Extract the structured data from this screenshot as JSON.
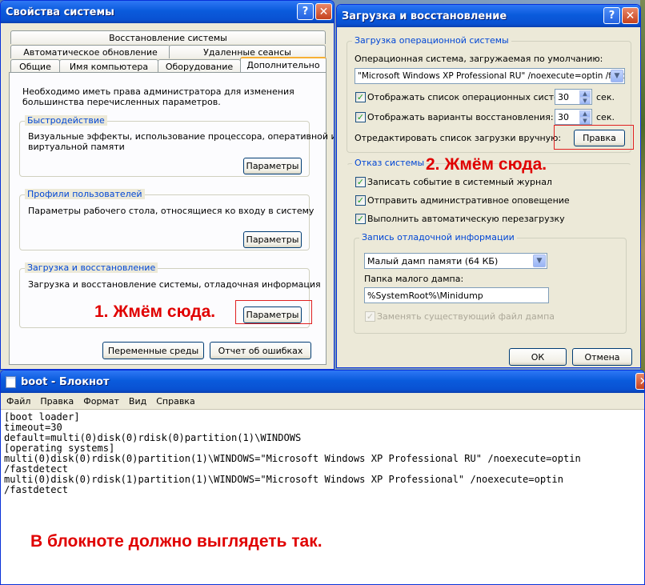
{
  "system_properties": {
    "title": "Свойства системы",
    "tabs_row1": [
      "Восстановление системы"
    ],
    "tabs_row2": [
      "Автоматическое обновление",
      "Удаленные сеансы"
    ],
    "tabs_row3": [
      "Общие",
      "Имя компьютера",
      "Оборудование",
      "Дополнительно"
    ],
    "intro": [
      "Необходимо иметь права администратора для изменения",
      "большинства перечисленных параметров."
    ],
    "performance": {
      "title": "Быстродействие",
      "text": [
        "Визуальные эффекты, использование процессора, оперативной и",
        "виртуальной памяти"
      ],
      "button": "Параметры"
    },
    "profiles": {
      "title": "Профили пользователей",
      "text": "Параметры рабочего стола, относящиеся ко входу в систему",
      "button": "Параметры"
    },
    "startup": {
      "title": "Загрузка и восстановление",
      "text": "Загрузка и восстановление системы, отладочная информация",
      "button": "Параметры"
    },
    "env_button": "Переменные среды",
    "error_button": "Отчет об ошибках"
  },
  "startup_recovery": {
    "title": "Загрузка и восстановление",
    "os_group": {
      "title": "Загрузка операционной системы",
      "default_label": "Операционная система, загружаемая по умолчанию:",
      "default_value": "\"Microsoft Windows XP Professional RU\" /noexecute=optin /fastd",
      "show_list_label": "Отображать список операционных систем:",
      "show_list_value": "30",
      "show_recovery_label": "Отображать варианты восстановления:",
      "show_recovery_value": "30",
      "sec": "сек.",
      "edit_label": "Отредактировать список загрузки вручную:",
      "edit_button": "Правка"
    },
    "failure_group": {
      "title": "Отказ системы",
      "opt1": "Записать событие в системный журнал",
      "opt2": "Отправить административное оповещение",
      "opt3": "Выполнить автоматическую перезагрузку"
    },
    "debug_group": {
      "title": "Запись отладочной информации",
      "dump_type": "Малый дамп памяти (64 КБ)",
      "folder_label": "Папка малого дампа:",
      "folder_value": "%SystemRoot%\\Minidump",
      "overwrite": "Заменять существующий файл дампа"
    },
    "ok": "ОК",
    "cancel": "Отмена"
  },
  "notepad": {
    "title": "boot - Блокнот",
    "menu": [
      "Файл",
      "Правка",
      "Формат",
      "Вид",
      "Справка"
    ],
    "lines": [
      "[boot loader]",
      "timeout=30",
      "default=multi(0)disk(0)rdisk(0)partition(1)\\WINDOWS",
      "[operating systems]",
      "multi(0)disk(0)rdisk(0)partition(1)\\WINDOWS=\"Microsoft Windows XP Professional RU\" /noexecute=optin",
      "/fastdetect",
      "multi(0)disk(0)rdisk(1)partition(1)\\WINDOWS=\"Microsoft Windows XP Professional\" /noexecute=optin",
      "/fastdetect"
    ]
  },
  "annotations": {
    "step1": "1. Жмём сюда.",
    "step2": "2. Жмём сюда.",
    "notepad_note": "В блокноте должно выглядеть так."
  },
  "colors": {
    "annotation": "#e00000",
    "xp_title": "#0a5bdc",
    "group_title": "#0046d5"
  }
}
